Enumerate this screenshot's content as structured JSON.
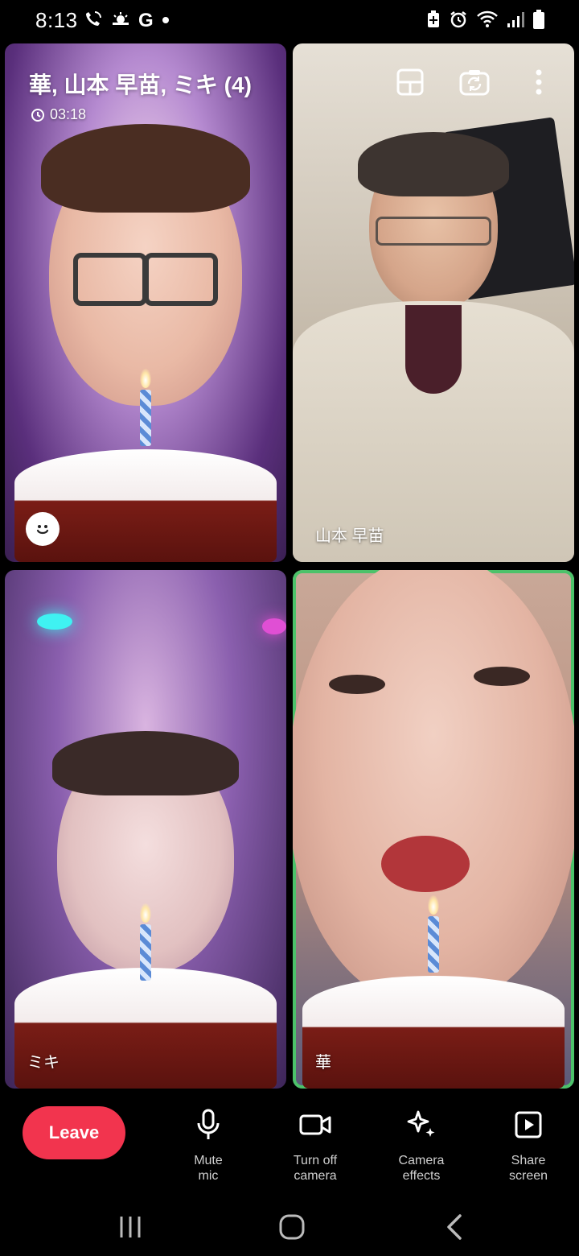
{
  "status_bar": {
    "time": "8:13",
    "left_icons": [
      "wifi-call-icon",
      "weather-icon",
      "google-icon",
      "notification-dot-icon"
    ],
    "right_icons": [
      "battery-saver-icon",
      "alarm-icon",
      "wifi-icon",
      "signal-icon",
      "battery-icon"
    ]
  },
  "call": {
    "title": "華, 山本 早苗, ミキ (4)",
    "timer": "03:18"
  },
  "participants": [
    {
      "name": ""
    },
    {
      "name": "山本 早苗"
    },
    {
      "name": "ミキ"
    },
    {
      "name": "華",
      "active_speaker": true,
      "highlight_color": "#4cc26a"
    }
  ],
  "top_actions": [
    {
      "icon": "layout-icon"
    },
    {
      "icon": "switch-camera-icon"
    },
    {
      "icon": "more-icon"
    }
  ],
  "controls": {
    "leave_label": "Leave",
    "leave_color": "#f2344e",
    "mute": "Mute\nmic",
    "camera": "Turn off\ncamera",
    "effects": "Camera\neffects",
    "share": "Share\nscreen"
  },
  "nav": {
    "icons": [
      "recent-apps-icon",
      "home-icon",
      "back-icon"
    ]
  }
}
